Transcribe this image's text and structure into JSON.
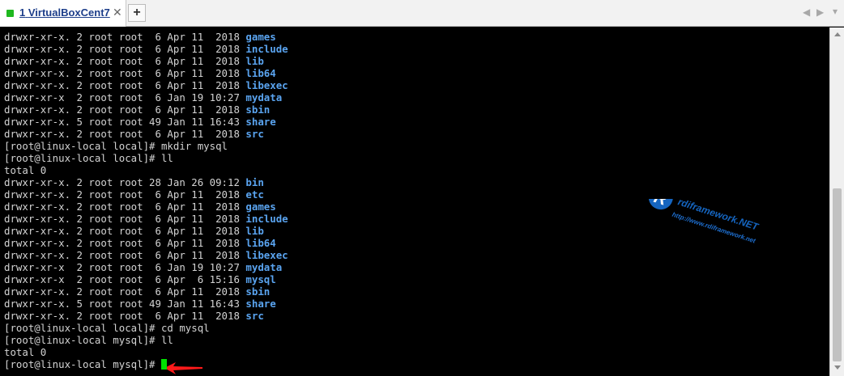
{
  "tab": {
    "number": "1",
    "title": "VirtualBoxCent7",
    "close_glyph": "✕"
  },
  "add_tab_label": "+",
  "nav": {
    "left": "◀",
    "right": "▶",
    "menu": "▾"
  },
  "terminal": {
    "lines": [
      {
        "text": "drwxr-xr-x. 2 root root  6 Apr 11  2018 ",
        "dir": "games"
      },
      {
        "text": "drwxr-xr-x. 2 root root  6 Apr 11  2018 ",
        "dir": "include"
      },
      {
        "text": "drwxr-xr-x. 2 root root  6 Apr 11  2018 ",
        "dir": "lib"
      },
      {
        "text": "drwxr-xr-x. 2 root root  6 Apr 11  2018 ",
        "dir": "lib64"
      },
      {
        "text": "drwxr-xr-x. 2 root root  6 Apr 11  2018 ",
        "dir": "libexec"
      },
      {
        "text": "drwxr-xr-x  2 root root  6 Jan 19 10:27 ",
        "dir": "mydata"
      },
      {
        "text": "drwxr-xr-x. 2 root root  6 Apr 11  2018 ",
        "dir": "sbin"
      },
      {
        "text": "drwxr-xr-x. 5 root root 49 Jan 11 16:43 ",
        "dir": "share"
      },
      {
        "text": "drwxr-xr-x. 2 root root  6 Apr 11  2018 ",
        "dir": "src"
      },
      {
        "text": "[root@linux-local local]# mkdir mysql",
        "dir": ""
      },
      {
        "text": "[root@linux-local local]# ll",
        "dir": ""
      },
      {
        "text": "total 0",
        "dir": ""
      },
      {
        "text": "drwxr-xr-x. 2 root root 28 Jan 26 09:12 ",
        "dir": "bin"
      },
      {
        "text": "drwxr-xr-x. 2 root root  6 Apr 11  2018 ",
        "dir": "etc"
      },
      {
        "text": "drwxr-xr-x. 2 root root  6 Apr 11  2018 ",
        "dir": "games"
      },
      {
        "text": "drwxr-xr-x. 2 root root  6 Apr 11  2018 ",
        "dir": "include"
      },
      {
        "text": "drwxr-xr-x. 2 root root  6 Apr 11  2018 ",
        "dir": "lib"
      },
      {
        "text": "drwxr-xr-x. 2 root root  6 Apr 11  2018 ",
        "dir": "lib64"
      },
      {
        "text": "drwxr-xr-x. 2 root root  6 Apr 11  2018 ",
        "dir": "libexec"
      },
      {
        "text": "drwxr-xr-x  2 root root  6 Jan 19 10:27 ",
        "dir": "mydata"
      },
      {
        "text": "drwxr-xr-x  2 root root  6 Apr  6 15:16 ",
        "dir": "mysql"
      },
      {
        "text": "drwxr-xr-x. 2 root root  6 Apr 11  2018 ",
        "dir": "sbin"
      },
      {
        "text": "drwxr-xr-x. 5 root root 49 Jan 11 16:43 ",
        "dir": "share"
      },
      {
        "text": "drwxr-xr-x. 2 root root  6 Apr 11  2018 ",
        "dir": "src"
      },
      {
        "text": "[root@linux-local local]# cd mysql",
        "dir": ""
      },
      {
        "text": "[root@linux-local mysql]# ll",
        "dir": ""
      },
      {
        "text": "total 0",
        "dir": ""
      },
      {
        "text": "[root@linux-local mysql]# ",
        "dir": ""
      }
    ]
  },
  "watermark": {
    "logo_letter": "R",
    "name": "rdiframework.NET",
    "url": "http://www.rdiframework.net"
  },
  "colors": {
    "terminal_bg": "#000000",
    "terminal_fg": "#d3d3d3",
    "directory": "#5aa4f0",
    "cursor": "#00e000",
    "arrow": "#ff1a1a",
    "tab_status": "#1fb81f",
    "watermark": "#1565c0"
  }
}
